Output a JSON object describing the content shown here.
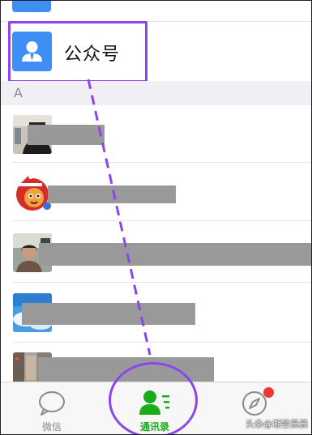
{
  "official_accounts": {
    "label": "公众号",
    "icon": "user-icon"
  },
  "section": {
    "letter": "A"
  },
  "contacts": [
    {
      "avatar": "photo-avatar"
    },
    {
      "avatar": "cartoon-avatar"
    },
    {
      "avatar": "photo-avatar"
    },
    {
      "avatar": "sky-avatar"
    },
    {
      "avatar": "street-avatar"
    }
  ],
  "tabbar": {
    "tabs": [
      {
        "label": "微信",
        "icon": "chat-bubble-icon",
        "active": false
      },
      {
        "label": "通讯录",
        "icon": "contacts-icon",
        "active": true
      },
      {
        "label": "",
        "icon": "compass-icon",
        "active": false,
        "badge": true
      }
    ]
  },
  "watermark": "头条@湘警晨晨",
  "colors": {
    "accent_green": "#1aad19",
    "highlight_purple": "#8e44ec",
    "icon_blue": "#3d8ef5",
    "badge_red": "#f43530"
  }
}
